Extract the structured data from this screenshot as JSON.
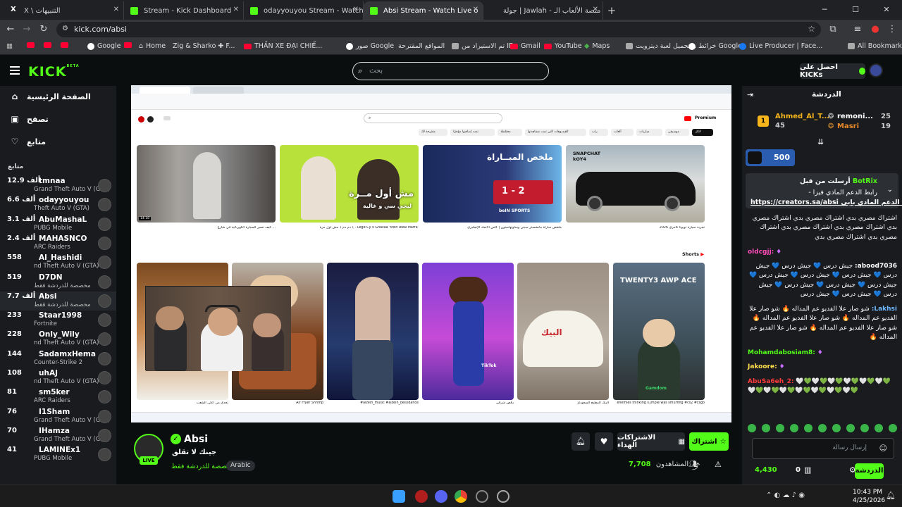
{
  "browser": {
    "tabs": [
      {
        "label": "X \\ التنبيهات",
        "active": false
      },
      {
        "label": "Stream - Kick Dashboard",
        "active": false
      },
      {
        "label": "odayyouyou Stream - Watch Li",
        "active": false
      },
      {
        "label": "Absi Stream - Watch Live o",
        "active": true
      },
      {
        "label": "جولة | Jawlah - منصة الألعاب الـ",
        "active": false
      }
    ],
    "url": "kick.com/absi",
    "bookmarks": [
      "Google",
      "Home",
      "Zig & Sharko ✚ F...",
      "THẦN XE ĐẠI CHIẾ...",
      "صور Google",
      "المواقع المقترحة",
      "تم الاستيراد من IE",
      "Gmail",
      "YouTube",
      "Maps",
      "تحميل لعبة ديترويت...",
      "خرائط Google",
      "Live Producer | Face...",
      "All Bookmarks"
    ]
  },
  "kick": {
    "logo": "KICK",
    "logo_beta": "BETA",
    "search_placeholder": "بحث",
    "get_kicks": "احصل على KICKs"
  },
  "sidebar": {
    "nav": [
      {
        "label": "الصفحة الرئيسية",
        "icon": "home-icon"
      },
      {
        "label": "تصفح",
        "icon": "browse-icon"
      },
      {
        "label": "متابع",
        "icon": "heart-icon"
      }
    ],
    "following_header": "متابع",
    "channels": [
      {
        "name": "tmnaa",
        "viewers": "12.9 ألف",
        "category": "Grand Theft Auto V (GTA)",
        "cat_shown": "Theft Auto V (GTA)"
      },
      {
        "name": "odayyouyou",
        "viewers": "6.6 ألف",
        "category": "Theft Auto V (GTA)"
      },
      {
        "name": "AbuMashaL",
        "viewers": "3.1 ألف",
        "category": "PUBG Mobile"
      },
      {
        "name": "MAHASNCO",
        "viewers": "2.4 ألف",
        "category": "ARC Raiders"
      },
      {
        "name": "Al_Hashidi",
        "viewers": "558",
        "category": "nd Theft Auto V (GTA)"
      },
      {
        "name": "D7DN",
        "viewers": "519",
        "category": "مخصصة للدردشة فقط"
      },
      {
        "name": "Absi",
        "viewers": "7.7 ألف",
        "category": "مخصصة للدردشة فقط",
        "selected": true
      },
      {
        "name": "Staar1998",
        "viewers": "233",
        "category": "Fortnite"
      },
      {
        "name": "Only_Wily",
        "viewers": "228",
        "category": "nd Theft Auto V (GTA)"
      },
      {
        "name": "SadamxHema",
        "viewers": "144",
        "category": "Counter-Strike 2"
      },
      {
        "name": "uhAJ",
        "viewers": "108",
        "category": "nd Theft Auto V (GTA)"
      },
      {
        "name": "sm5ker",
        "viewers": "81",
        "category": "ARC Raiders"
      },
      {
        "name": "I1Sham",
        "viewers": "76",
        "category": "Grand Theft Auto V (GTA)"
      },
      {
        "name": "IHamza",
        "viewers": "70",
        "category": "Grand Theft Auto V (GTA)"
      },
      {
        "name": "LAMINEx1",
        "viewers": "41",
        "category": "PUBG Mobile"
      }
    ]
  },
  "video": {
    "yt_search": "",
    "chips": [
      "الكل",
      "موسيقى",
      "مباريات",
      "ألعاب",
      "راب",
      "الفيديوهات التي تمت مشاهدتها",
      "مختلطة",
      "تمت إضافتها مؤخرًا",
      "مقترحة لك"
    ],
    "thumbs": [
      {
        "title": "كيف تسير السيارة الكهربائية في شارع ...",
        "badge": "",
        "duration": "14:18"
      },
      {
        "title": "دم دم ﴿ مش أول مرة ﴾ - Lege-Cy x Ghaliaa 'Mish Awal Marra'",
        "overlay": "مش أول مــرة",
        "overlay2": "ليجي سي و غالية"
      },
      {
        "title": "ملخص مباراة مانشستر سيتي وساوثهامبتون | كأس الاتحاد الإنجليزي",
        "overlay": "ملخص المبــاراة",
        "score": "1 - 2",
        "channel": "beIN SPORTS"
      },
      {
        "title": "تجربة سيارة تويوتا كامري 2026",
        "overlay": "SNAPCHAT kOY4"
      }
    ],
    "shorts_label": "Shorts",
    "shorts": [
      {
        "title": "تحدي من أعلى الشعب"
      },
      {
        "title": "Air Fryer Shrimp"
      },
      {
        "title": "#alzein_music #alzein_bellydance"
      },
      {
        "title": "رقص شرقي",
        "wm": "TikTok"
      },
      {
        "title": "البيك المطبخ السعودي",
        "box": "البيك"
      },
      {
        "title": "enemies thinking s1mple was smurfing #cs2 #csgo",
        "overlay": "TWENTY3 AWP ACE",
        "brand": "Gamdom"
      }
    ]
  },
  "stream": {
    "name": "Absi",
    "title": "جينك لا تقلق",
    "category": "مخصصة للدردشة فقط",
    "language": "Arabic",
    "live": "LIVE",
    "subscribe": "اشتراك",
    "gift": "الاشتراكات الهداء",
    "viewers_value": "7,708",
    "viewers_label": "المشاهدون"
  },
  "chat": {
    "header": "الدردشة",
    "top_gifters": [
      {
        "name": "Ahmed_Al_T...",
        "count": "45"
      },
      {
        "name": "remoni...",
        "count": "25"
      },
      {
        "name": "Masri",
        "count": "19"
      }
    ],
    "kickpot": "500",
    "pinned_by": "أرسلت من قبل",
    "pinned_user": "BotRix",
    "pinned_line1": "- رابط الدعم المادي فيزا",
    "pinned_line2": "https://creators.sa/absi رابط الدعم المادي بايي",
    "messages": [
      {
        "user": "",
        "text": "اشتراك مصري بدي اشتراك مصري بدي اشتراك مصري بدي اشتراك مصري بدي اشتراك مصري بدي اشتراك مصري بدي اشتراك مصري بدي"
      },
      {
        "user": "oldcgjj:",
        "text": ""
      },
      {
        "user": "abood7036:",
        "text": "جيش درس 💙 جيش درس 💙 جيش درس 💙 جيش درس 💙 جيش درس 💙 جيش درس 💙 جيش درس 💙 جيش درس 💙 جيش درس 💙 جيش درس 💙 جيش درس 💙 جيش درس"
      },
      {
        "user": "Lakhsi:",
        "text": "شو صار علا الفديو عم المداله 🔥 شو صار علا الفديو عم المداله 🔥 شو صار علا الفديو عم المداله 🔥 شو صار علا الفديو عم المداله 🔥 شو صار علا الفديو عم المداله 🔥"
      },
      {
        "user": "Mohamdabosiam8:",
        "text": ""
      },
      {
        "user": "Jakoore:",
        "text": ""
      },
      {
        "user": "AbuSa6eh_2:",
        "text": "🤍💚🤍💚🤍💚🤍💚🤍💚🤍💚🤍💚🤍💚🤍💚🤍💚🤍💚🤍💚🤍💚"
      }
    ],
    "input_placeholder": "إرسال رسالة",
    "points": "4,430",
    "zero": "0",
    "send": "الدردشة"
  },
  "taskbar": {
    "time": "10:43 PM",
    "date": "4/25/2026"
  }
}
